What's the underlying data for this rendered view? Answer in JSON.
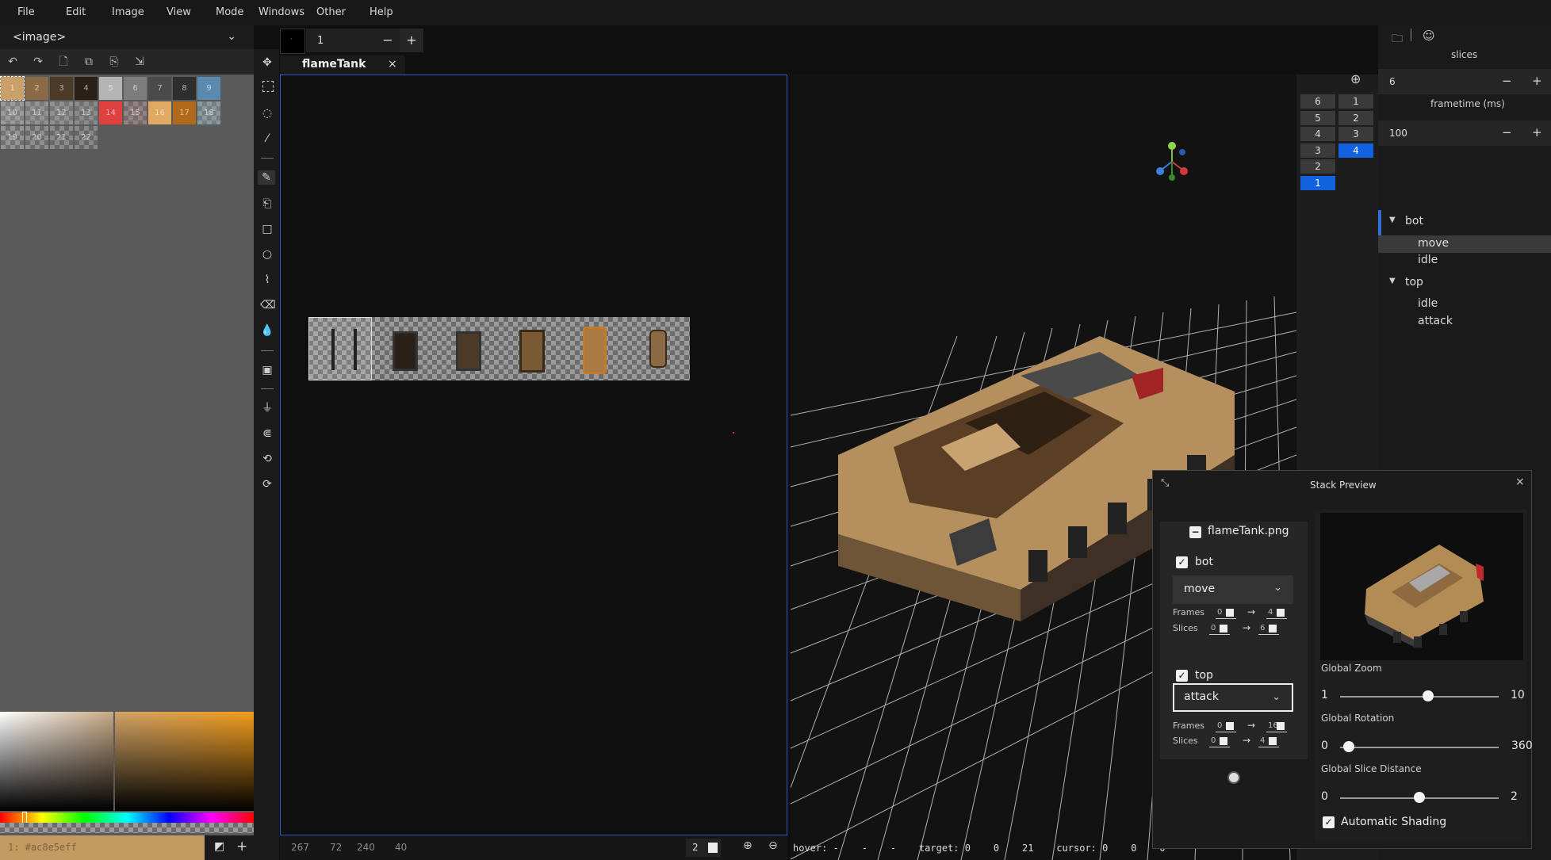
{
  "menu": [
    "File",
    "Edit",
    "Image",
    "View",
    "Mode",
    "Windows",
    "Other",
    "Help"
  ],
  "image_select": {
    "value": "<image>"
  },
  "palette": {
    "swatches": [
      {
        "label": "1",
        "color": "#c9a06a"
      },
      {
        "label": "2",
        "color": "#8a6a44"
      },
      {
        "label": "3",
        "color": "#4b3a26"
      },
      {
        "label": "4",
        "color": "#2a2018"
      },
      {
        "label": "5",
        "color": "#b4b4b4"
      },
      {
        "label": "6",
        "color": "#7c7c7c"
      },
      {
        "label": "7",
        "color": "#4a4a4a"
      },
      {
        "label": "8",
        "color": "#2e2e2e"
      },
      {
        "label": "9",
        "color": "#5a8ab0"
      },
      {
        "label": "10",
        "color": "#9c9c9c"
      },
      {
        "label": "11",
        "color": "#8c8c8c"
      },
      {
        "label": "12",
        "color": "#868686"
      },
      {
        "label": "13",
        "color": "#7a7a7a"
      },
      {
        "label": "14",
        "color": "#e04040"
      },
      {
        "label": "15",
        "color": "#8a6a6a"
      },
      {
        "label": "16",
        "color": "#e0a860"
      },
      {
        "label": "17",
        "color": "#b06a1a"
      },
      {
        "label": "18",
        "color": "#7a9aa0"
      },
      {
        "label": "19",
        "color": "#808080"
      },
      {
        "label": "20",
        "color": "#6a6a6a"
      },
      {
        "label": "21",
        "color": "#5c5c5c"
      },
      {
        "label": "22",
        "color": "#525252"
      }
    ],
    "selected": "1"
  },
  "color": {
    "hex_text": "1: #ac8e5eff"
  },
  "brush": {
    "size": "1",
    "minus": "−",
    "plus": "+"
  },
  "tab": {
    "title": "flameTank",
    "close": "×"
  },
  "canvas_status": {
    "values": [
      "267",
      "72",
      "240",
      "40"
    ],
    "zoom_value": "2"
  },
  "status3d": {
    "text": "hover: -    -    -    target: 0    0    21    cursor: 0    0    0"
  },
  "frames_panel": {
    "left": [
      "6",
      "5",
      "4",
      "3",
      "2",
      "1"
    ],
    "right": [
      "1",
      "2",
      "3",
      "4"
    ],
    "left_selected": "1",
    "right_selected": "4"
  },
  "right_panel": {
    "slices_label": "slices",
    "slices_value": "6",
    "frametime_label": "frametime (ms)",
    "frametime_value": "100",
    "minus": "−",
    "plus": "+",
    "tree": [
      {
        "label": "bot",
        "type": "group"
      },
      {
        "label": "move",
        "type": "leaf",
        "selected": true
      },
      {
        "label": "idle",
        "type": "leaf"
      },
      {
        "label": "top",
        "type": "group"
      },
      {
        "label": "idle",
        "type": "leaf"
      },
      {
        "label": "attack",
        "type": "leaf"
      }
    ]
  },
  "stack_preview": {
    "title": "Stack Preview",
    "file": "flameTank.png",
    "bot": {
      "label": "bot",
      "anim": "move",
      "frames_label": "Frames",
      "frames_from": "0",
      "frames_to": "4",
      "slices_label": "Slices",
      "slices_from": "0",
      "slices_to": "6"
    },
    "top": {
      "label": "top",
      "anim": "attack",
      "frames_label": "Frames",
      "frames_from": "0",
      "frames_to": "16",
      "slices_label": "Slices",
      "slices_from": "0",
      "slices_to": "4"
    },
    "arrow": "→",
    "global_zoom": {
      "label": "Global Zoom",
      "min": "1",
      "max": "10",
      "value": 6
    },
    "global_rotation": {
      "label": "Global Rotation",
      "min": "0",
      "max": "360",
      "value": 20
    },
    "global_slice_distance": {
      "label": "Global Slice Distance",
      "min": "0",
      "max": "2",
      "value": 1
    },
    "automatic_shading": {
      "label": "Automatic Shading",
      "checked": true
    }
  }
}
